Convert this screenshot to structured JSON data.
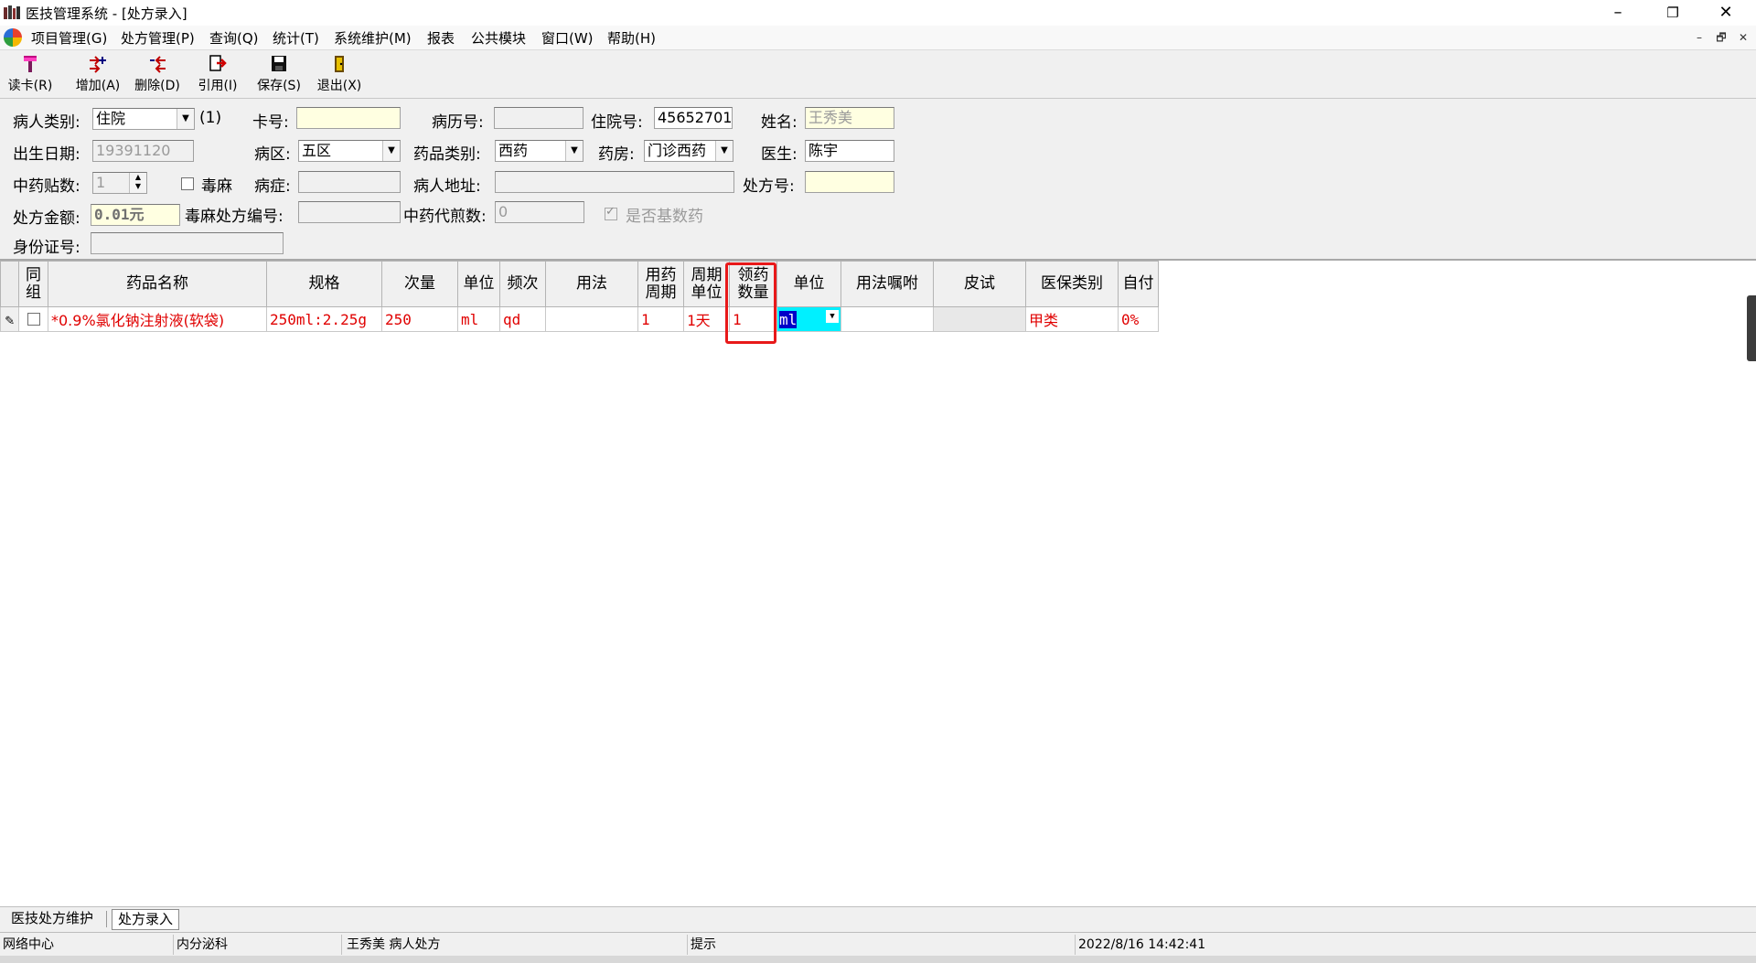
{
  "window": {
    "title": "医技管理系统 - [处方录入]",
    "minimize": "–",
    "restore": "❐",
    "close": "✕"
  },
  "menu": {
    "items": [
      "项目管理(G)",
      "处方管理(P)",
      "查询(Q)",
      "统计(T)",
      "系统维护(M)",
      "报表",
      "公共模块",
      "窗口(W)",
      "帮助(H)"
    ],
    "mdi_min": "–",
    "mdi_restore": "🗗",
    "mdi_close": "✕"
  },
  "toolbar": {
    "items": [
      {
        "label": "读卡(R)",
        "icon": "card-reader-icon"
      },
      {
        "label": "增加(A)",
        "icon": "add-icon"
      },
      {
        "label": "删除(D)",
        "icon": "delete-icon"
      },
      {
        "label": "引用(I)",
        "icon": "reference-icon"
      },
      {
        "label": "保存(S)",
        "icon": "save-icon"
      },
      {
        "label": "退出(X)",
        "icon": "exit-icon"
      }
    ]
  },
  "form": {
    "patient_type": {
      "label": "病人类别:",
      "value": "住院",
      "suffix": "(1)"
    },
    "card_no": {
      "label": "卡号:",
      "value": ""
    },
    "record_no": {
      "label": "病历号:",
      "value": ""
    },
    "inpatient_no": {
      "label": "住院号:",
      "value": "45652701"
    },
    "name": {
      "label": "姓名:",
      "value": "王秀美"
    },
    "birth_date": {
      "label": "出生日期:",
      "value": "19391120"
    },
    "ward": {
      "label": "病区:",
      "value": "五区"
    },
    "drug_category": {
      "label": "药品类别:",
      "value": "西药"
    },
    "pharmacy": {
      "label": "药房:",
      "value": "门诊西药"
    },
    "doctor": {
      "label": "医生:",
      "value": "陈宇"
    },
    "herb_count": {
      "label": "中药贴数:",
      "value": "1"
    },
    "narcotic": {
      "label": "毒麻",
      "checked": false
    },
    "diagnosis": {
      "label": "病症:",
      "value": ""
    },
    "address": {
      "label": "病人地址:",
      "value": ""
    },
    "rx_no": {
      "label": "处方号:",
      "value": ""
    },
    "rx_amount": {
      "label": "处方金额:",
      "value": "0.01元"
    },
    "narcotic_rx_no": {
      "label": "毒麻处方编号:",
      "value": ""
    },
    "decoction_count": {
      "label": "中药代煎数:",
      "value": "0"
    },
    "essential_drug": {
      "label": "是否基数药",
      "checked": true
    },
    "id_card": {
      "label": "身份证号:",
      "value": ""
    }
  },
  "grid": {
    "headers": [
      [
        "同",
        "组"
      ],
      [
        "药品名称"
      ],
      [
        "规格"
      ],
      [
        "次量"
      ],
      [
        "单位"
      ],
      [
        "频次"
      ],
      [
        "用法"
      ],
      [
        "用药",
        "周期"
      ],
      [
        "周期",
        "单位"
      ],
      [
        "领药",
        "数量"
      ],
      [
        "单位"
      ],
      [
        "用法嘱咐"
      ],
      [
        "皮试"
      ],
      [
        "医保类别"
      ],
      [
        "自付"
      ]
    ],
    "rows": [
      {
        "group": false,
        "cells": [
          "*0.9%氯化钠注射液(软袋)",
          "250ml:2.25g",
          "250",
          "ml",
          "qd",
          "",
          "1",
          "1天",
          "1",
          "ml",
          "",
          "",
          "甲类",
          "0%"
        ]
      }
    ]
  },
  "tabs": [
    "医技处方维护",
    "处方录入"
  ],
  "active_tab": 1,
  "status": {
    "center": "网络中心",
    "department": "内分泌科",
    "patient_rx": "王秀美 病人处方",
    "hint": "提示",
    "datetime": "2022/8/16 14:42:41"
  }
}
